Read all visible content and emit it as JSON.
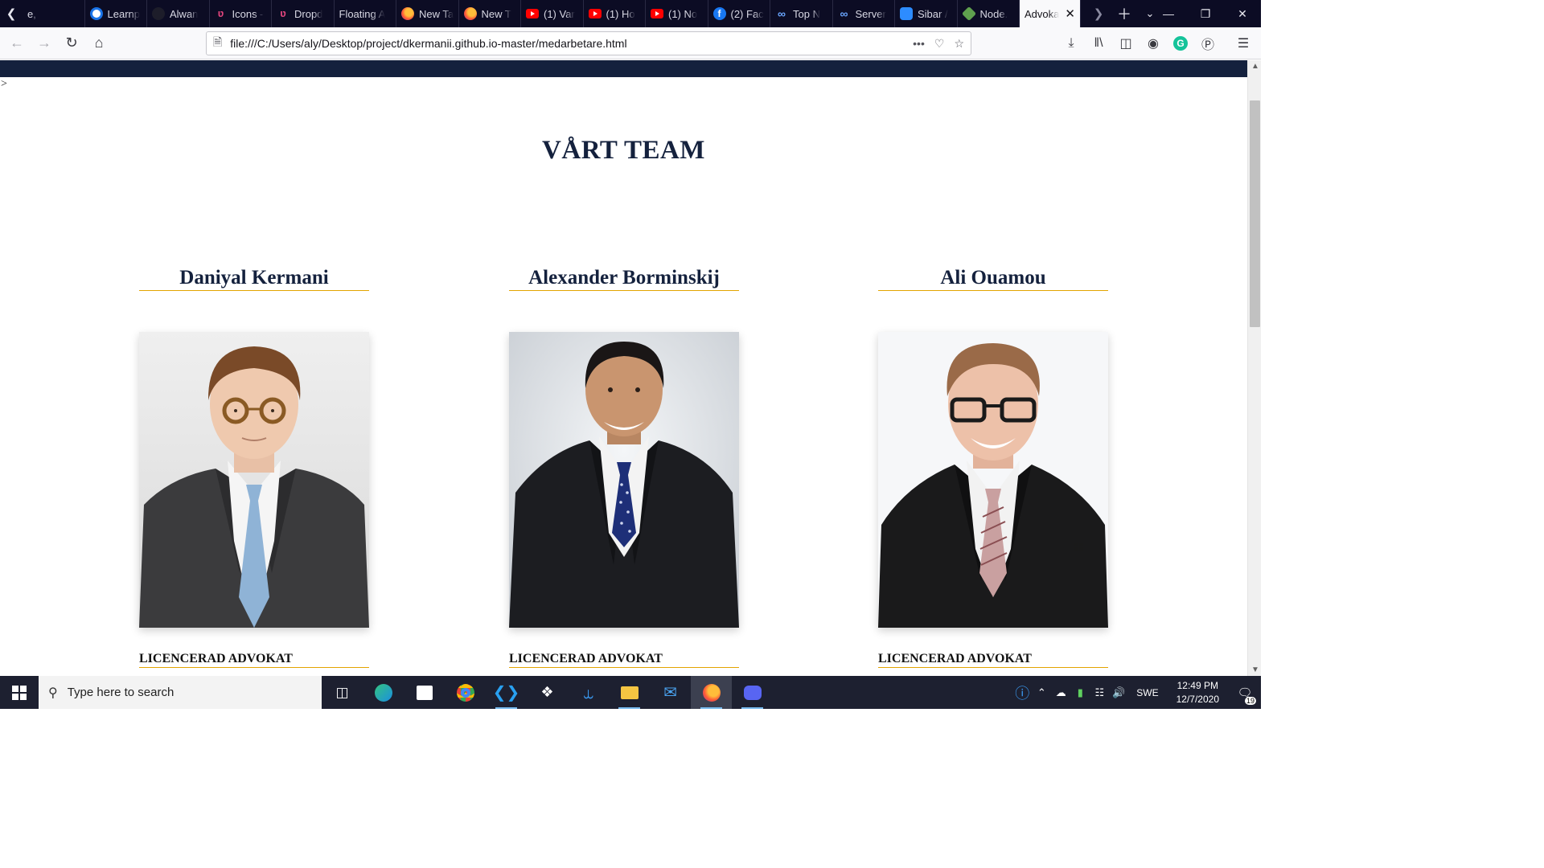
{
  "browser": {
    "tabs": [
      {
        "label": "e,",
        "icon": "generic-icon",
        "active": false
      },
      {
        "label": "Learnp",
        "icon": "ring-icon",
        "active": false
      },
      {
        "label": "Alwan",
        "icon": "dark-icon",
        "active": false
      },
      {
        "label": "Icons -",
        "icon": "m-logo-icon",
        "active": false
      },
      {
        "label": "Dropd",
        "icon": "m-logo-icon",
        "active": false
      },
      {
        "label": "Floating A",
        "icon": "none",
        "active": false
      },
      {
        "label": "New Ta",
        "icon": "firefox-icon",
        "active": false
      },
      {
        "label": "New T",
        "icon": "firefox-icon",
        "active": false
      },
      {
        "label": "(1) Var",
        "icon": "youtube-icon",
        "active": false
      },
      {
        "label": "(1) Ho",
        "icon": "youtube-icon",
        "active": false
      },
      {
        "label": "(1) No",
        "icon": "youtube-icon",
        "active": false
      },
      {
        "label": "(2) Fac",
        "icon": "facebook-icon",
        "active": false
      },
      {
        "label": "Top N",
        "icon": "infinity-icon",
        "active": false
      },
      {
        "label": "Server",
        "icon": "infinity-icon",
        "active": false
      },
      {
        "label": "Sibar /",
        "icon": "zoom-icon",
        "active": false
      },
      {
        "label": "Node.",
        "icon": "node-icon",
        "active": false
      },
      {
        "label": "Advoka",
        "icon": "none",
        "active": true
      }
    ],
    "url": "file:///C:/Users/aly/Desktop/project/dkermanii.github.io-master/medarbetare.html"
  },
  "page": {
    "stray_text": ">",
    "title": "VÅRT TEAM",
    "members": [
      {
        "name": "Daniyal Kermani",
        "role": "LICENCERAD ADVOKAT",
        "photo": "portrait-glasses-light-blue-tie"
      },
      {
        "name": "Alexander Borminskij",
        "role": "LICENCERAD ADVOKAT",
        "photo": "portrait-dark-suit-polka-dot-tie"
      },
      {
        "name": "Ali Ouamou",
        "role": "LICENCERAD ADVOKAT",
        "photo": "portrait-glasses-striped-tie"
      }
    ]
  },
  "taskbar": {
    "search_placeholder": "Type here to search",
    "language": "SWE",
    "time": "12:49 PM",
    "date": "12/7/2020",
    "notification_count": "19"
  },
  "colors": {
    "navy": "#14213d",
    "gold": "#e3a400",
    "tabstrip": "#0c0c24"
  }
}
